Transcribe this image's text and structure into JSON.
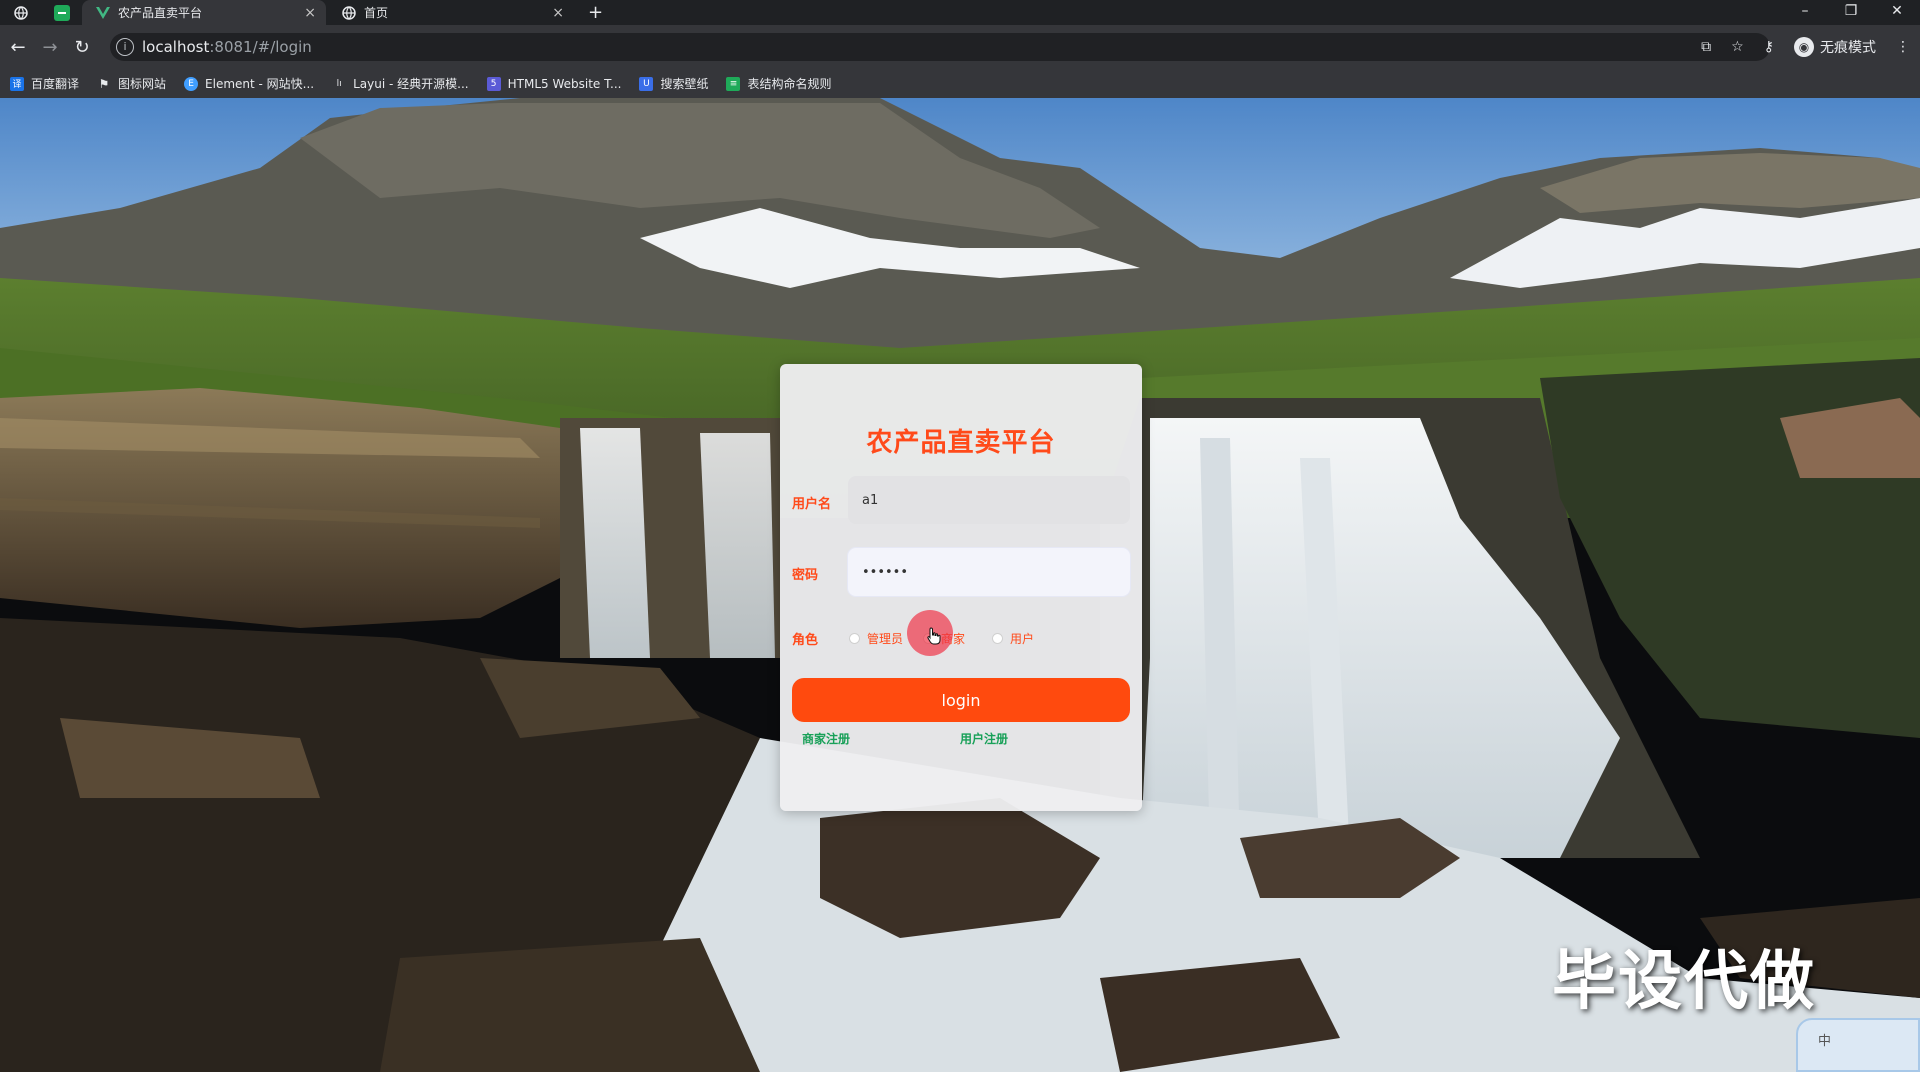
{
  "browser": {
    "tabs": [
      {
        "icon": "globe-icon",
        "label": ""
      },
      {
        "icon": "green-app-icon",
        "label": ""
      },
      {
        "icon": "vue-icon",
        "label": "农产品直卖平台",
        "active": true,
        "close": "×"
      },
      {
        "icon": "globe-icon",
        "label": "首页",
        "close": "×"
      }
    ],
    "new_tab": "+",
    "window_controls": {
      "minimize": "–",
      "restore": "❐",
      "close": "✕"
    },
    "address": {
      "host": "localhost",
      "path": ":8081/#/login"
    },
    "profile_label": "无痕模式",
    "bookmarks": [
      {
        "label": "百度翻译",
        "icon": "translate-icon",
        "color": "#1a73e8"
      },
      {
        "label": "图标网站",
        "icon": "flag-icon",
        "color": "#333333"
      },
      {
        "label": "Element - 网站快...",
        "icon": "element-icon",
        "color": "#409eff"
      },
      {
        "label": "Layui - 经典开源模...",
        "icon": "layui-icon",
        "color": "#5a5a5a"
      },
      {
        "label": "HTML5 Website T...",
        "icon": "html5-icon",
        "color": "#5b5bd6"
      },
      {
        "label": "搜索壁纸",
        "icon": "wallpaper-icon",
        "color": "#3a6ee8"
      },
      {
        "label": "表结构命名规则",
        "icon": "sheet-icon",
        "color": "#1faa59"
      }
    ]
  },
  "login": {
    "title": "农产品直卖平台",
    "username_label": "用户名",
    "username_value": "a1",
    "password_label": "密码",
    "password_value": "••••••",
    "role_label": "角色",
    "roles": [
      "管理员",
      "商家",
      "用户"
    ],
    "login_button": "login",
    "merchant_register": "商家注册",
    "user_register": "用户注册"
  },
  "overlay": {
    "watermark": "毕设代做",
    "ime_label": "中"
  },
  "colors": {
    "accent": "#ff4a1a",
    "button": "#ff4a0e",
    "link": "#18a058"
  }
}
